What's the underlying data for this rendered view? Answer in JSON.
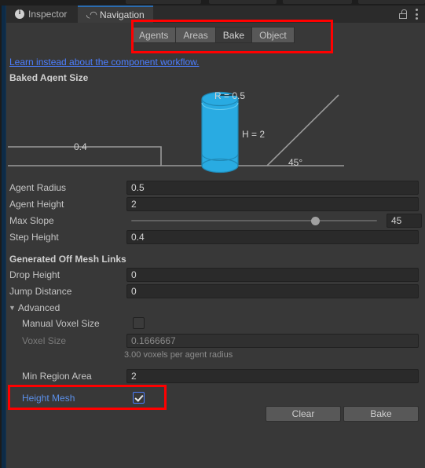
{
  "window": {
    "tabs": [
      {
        "label": "Inspector",
        "icon": "info-icon",
        "active": false
      },
      {
        "label": "Navigation",
        "icon": "navigation-icon",
        "active": true
      }
    ],
    "lock_icon": "lock-icon",
    "menu_icon": "kebab-menu-icon"
  },
  "modebar": {
    "buttons": [
      {
        "label": "Agents",
        "selected": false
      },
      {
        "label": "Areas",
        "selected": false
      },
      {
        "label": "Bake",
        "selected": true
      },
      {
        "label": "Object",
        "selected": false
      }
    ]
  },
  "link": {
    "text": "Learn instead about the component workflow."
  },
  "sections": {
    "baked_agent_size": "Baked Agent Size",
    "off_mesh_links": "Generated Off Mesh Links",
    "advanced": "Advanced"
  },
  "diagram": {
    "radius_label": "R = 0.5",
    "height_label": "H = 2",
    "step_label": "0.4",
    "slope_label": "45°",
    "agent_color": "#29abe2",
    "line_color": "#9a9a9a"
  },
  "fields": {
    "agent_radius": {
      "label": "Agent Radius",
      "value": "0.5"
    },
    "agent_height": {
      "label": "Agent Height",
      "value": "2"
    },
    "max_slope": {
      "label": "Max Slope",
      "value": "45"
    },
    "step_height": {
      "label": "Step Height",
      "value": "0.4"
    },
    "drop_height": {
      "label": "Drop Height",
      "value": "0"
    },
    "jump_distance": {
      "label": "Jump Distance",
      "value": "0"
    },
    "manual_voxel_size": {
      "label": "Manual Voxel Size",
      "checked": false
    },
    "voxel_size": {
      "label": "Voxel Size",
      "value": "0.1666667",
      "helper": "3.00 voxels per agent radius"
    },
    "min_region_area": {
      "label": "Min Region Area",
      "value": "2"
    },
    "height_mesh": {
      "label": "Height Mesh",
      "checked": true
    }
  },
  "actions": {
    "clear": "Clear",
    "bake": "Bake"
  },
  "annotation_color": "#ff0000"
}
